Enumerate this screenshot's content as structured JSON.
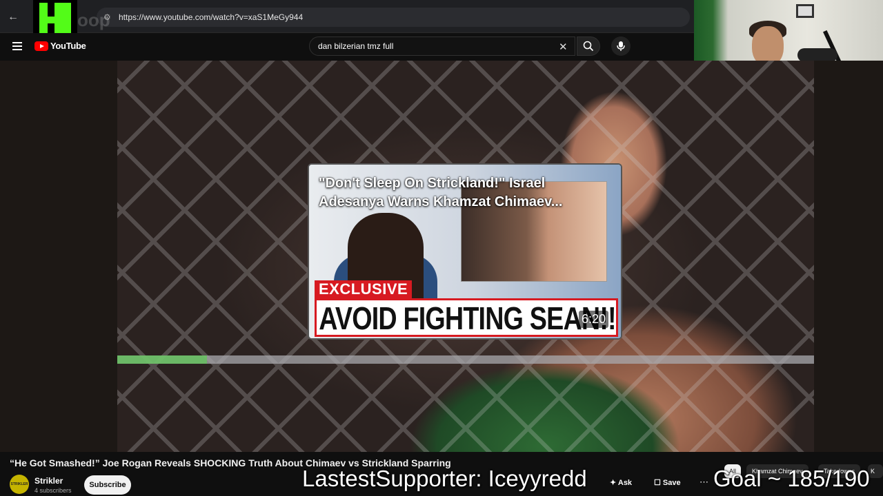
{
  "browser": {
    "url": "https://www.youtube.com/watch?v=xaS1MeGy944"
  },
  "youtube": {
    "logo_text": "YouTube",
    "search_value": "dan bilzerian tmz full"
  },
  "card": {
    "title": "\"Don't Sleep On Strickland!\" Israel Adesanya Warns Khamzat Chimaev...",
    "exclusive": "EXCLUSIVE",
    "headline": "AVOID FIGHTING SEAN!!",
    "duration": "6:20"
  },
  "video": {
    "title": "“He Got Smashed!” Joe Rogan Reveals SHOCKING Truth About Chimaev vs Strickland Sparring",
    "channel": "Strikler",
    "subscribers": "4 subscribers",
    "channel_avatar_text": "STRIKLER",
    "subscribe_label": "Subscribe",
    "ask_label": "Ask",
    "save_label": "Save"
  },
  "chips": [
    "All",
    "Khamzat Chimaev",
    "Takedowns",
    "K"
  ],
  "overlay": {
    "supporter": "LastestSupporter: Iceyyredd",
    "goal": "Goal ~ 185/190"
  },
  "colors": {
    "youtube_red": "#ff0000",
    "kick_green": "#53fc18",
    "background": "#0f0f0f"
  }
}
